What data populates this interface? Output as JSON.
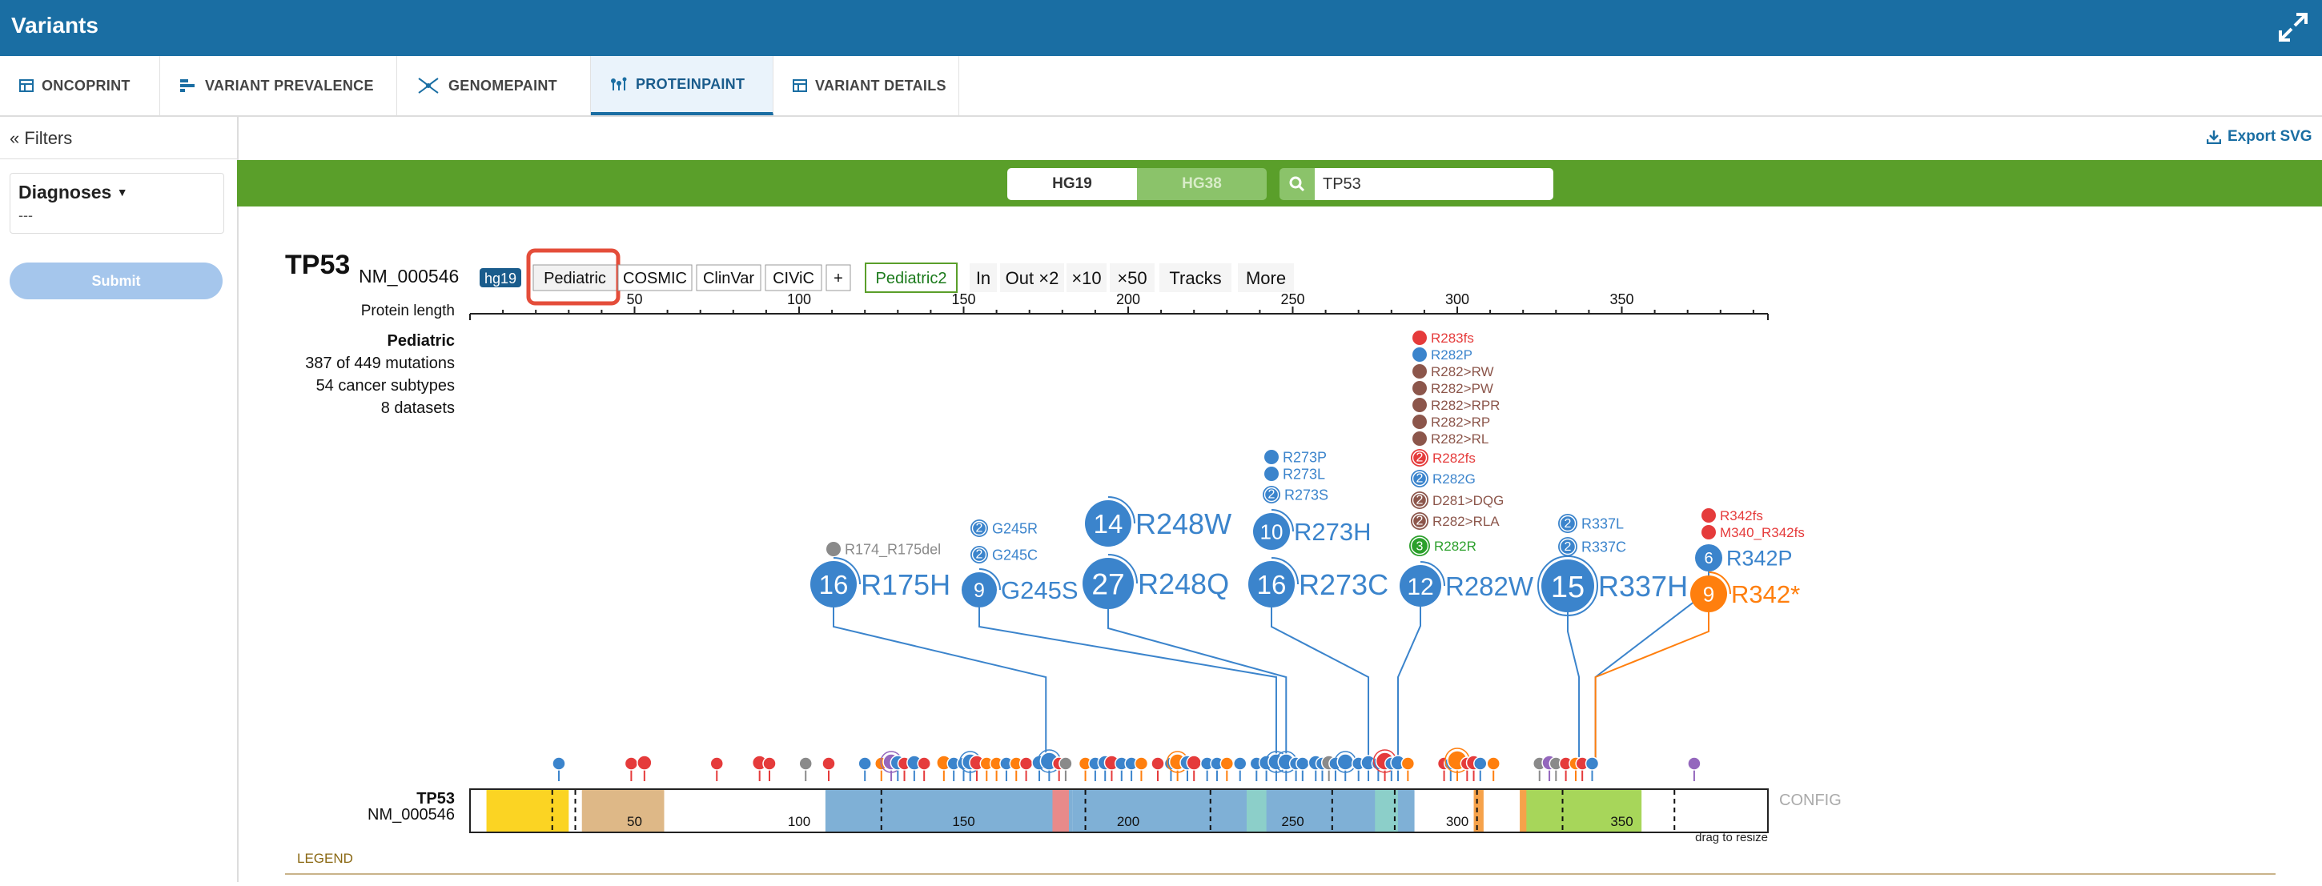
{
  "app": {
    "title": "Variants"
  },
  "tabs": [
    {
      "label": "ONCOPRINT",
      "icon": "table-icon"
    },
    {
      "label": "VARIANT PREVALENCE",
      "icon": "bar-chart-icon"
    },
    {
      "label": "GENOMEPAINT",
      "icon": "genome-icon"
    },
    {
      "label": "PROTEINPAINT",
      "icon": "lollipop-chart-icon",
      "active": true
    },
    {
      "label": "VARIANT DETAILS",
      "icon": "table-icon"
    }
  ],
  "sidebar": {
    "filters_label": "Filters",
    "diagnoses_label": "Diagnoses",
    "diagnoses_value": "---",
    "submit_label": "Submit"
  },
  "export_label": "Export SVG",
  "genome_toggle": {
    "hg19": "HG19",
    "hg38": "HG38",
    "active": "hg19"
  },
  "search": {
    "value": "TP53"
  },
  "proteinpaint": {
    "gene": "TP53",
    "transcript": "NM_000546",
    "build_badge": "hg19",
    "track_buttons": [
      "Pediatric",
      "COSMIC",
      "ClinVar",
      "CIViC",
      "+"
    ],
    "highlighted_button": "Pediatric",
    "pediatric2": "Pediatric2",
    "zoom_buttons": [
      "In",
      "Out ×2",
      "×10",
      "×50"
    ],
    "tracks_label": "Tracks",
    "more_label": "More",
    "protein_length_label": "Protein length",
    "axis_ticks": [
      "50",
      "100",
      "150",
      "200",
      "250",
      "300",
      "350"
    ],
    "dataset_name": "Pediatric",
    "mutation_summary": "387 of 449 mutations",
    "subtype_summary": "54 cancer subtypes",
    "dataset_summary": "8 datasets",
    "track_gene": "TP53",
    "track_transcript": "NM_000546",
    "config_label": "CONFIG",
    "drag_label": "drag to resize",
    "legend_label": "LEGEND",
    "domain_labels": [
      "50",
      "100",
      "150",
      "200",
      "250",
      "300",
      "350"
    ],
    "colors": {
      "missense": "#3b84cc",
      "frameshift": "#e53b3b",
      "nonsense": "#ff7f0e",
      "silent": "#2ca02c",
      "inframe": "#8c564b",
      "splice": "#8a8a8a",
      "other": "#9467bd"
    }
  },
  "mutations": [
    {
      "label": "R175H",
      "count": 16
    },
    {
      "label": "R174_R175del",
      "count": 1
    },
    {
      "label": "G245S",
      "count": 9
    },
    {
      "label": "G245R",
      "count": 2
    },
    {
      "label": "G245C",
      "count": 2
    },
    {
      "label": "R248W",
      "count": 14
    },
    {
      "label": "R248Q",
      "count": 27
    },
    {
      "label": "R273H",
      "count": 10
    },
    {
      "label": "R273C",
      "count": 16
    },
    {
      "label": "R273P",
      "count": 1
    },
    {
      "label": "R273L",
      "count": 1
    },
    {
      "label": "R273S",
      "count": 2
    },
    {
      "label": "R282W",
      "count": 12
    },
    {
      "label": "R283fs",
      "count": 1
    },
    {
      "label": "R282P",
      "count": 1
    },
    {
      "label": "R282>RW",
      "count": 1
    },
    {
      "label": "R282>PW",
      "count": 1
    },
    {
      "label": "R282>RPR",
      "count": 1
    },
    {
      "label": "R282>RP",
      "count": 1
    },
    {
      "label": "R282>RL",
      "count": 1
    },
    {
      "label": "R282fs",
      "count": 2
    },
    {
      "label": "R282G",
      "count": 2
    },
    {
      "label": "D281>DQG",
      "count": 2
    },
    {
      "label": "R282>RLA",
      "count": 2
    },
    {
      "label": "R282R",
      "count": 3
    },
    {
      "label": "R337H",
      "count": 15
    },
    {
      "label": "R337L",
      "count": 2
    },
    {
      "label": "R337C",
      "count": 2
    },
    {
      "label": "R342P",
      "count": 6
    },
    {
      "label": "R342*",
      "count": 9
    },
    {
      "label": "R342fs",
      "count": 1
    },
    {
      "label": "M340_R342fs",
      "count": 1
    }
  ]
}
